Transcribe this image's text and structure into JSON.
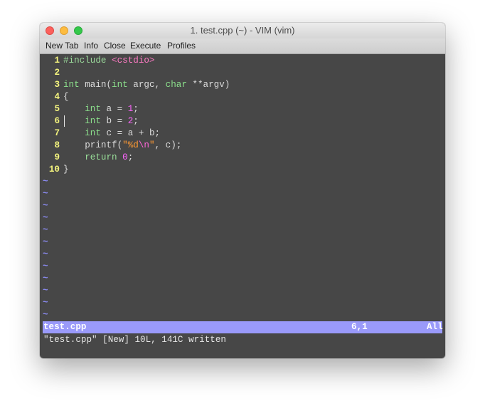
{
  "window": {
    "title": "1. test.cpp (~) - VIM (vim)"
  },
  "menu": [
    "New Tab",
    "Info",
    "Close",
    "Execute",
    "Profiles"
  ],
  "editor": {
    "lines": [
      {
        "n": "1"
      },
      {
        "n": "2"
      },
      {
        "n": "3"
      },
      {
        "n": "4"
      },
      {
        "n": "5"
      },
      {
        "n": "6"
      },
      {
        "n": "7"
      },
      {
        "n": "8"
      },
      {
        "n": "9"
      },
      {
        "n": "10"
      }
    ],
    "code": {
      "l1_pp": "#include ",
      "l1_hdr": "<cstdio>",
      "l3_int": "int",
      "l3_main": " main(",
      "l3_int2": "int",
      "l3_argc": " argc, ",
      "l3_char": "char",
      "l3_argv": " **argv)",
      "l4": "{",
      "l5_int": "int",
      "l5_rest": " a = ",
      "l5_num": "1",
      "l5_semi": ";",
      "l6_int": "int",
      "l6_rest": " b = ",
      "l6_num": "2",
      "l6_semi": ";",
      "l7_int": "int",
      "l7_rest": " c = a + b;",
      "l8_pre": "printf(",
      "l8_q1": "\"%d",
      "l8_esc": "\\n",
      "l8_q2": "\"",
      "l8_post": ", c);",
      "l9_ret": "return",
      "l9_sp": " ",
      "l9_num": "0",
      "l9_semi": ";",
      "l10": "}"
    },
    "tilde": "~"
  },
  "statusline": {
    "filename": "test.cpp",
    "position": "6,1",
    "scroll": "All"
  },
  "message": "\"test.cpp\" [New] 10L, 141C written"
}
